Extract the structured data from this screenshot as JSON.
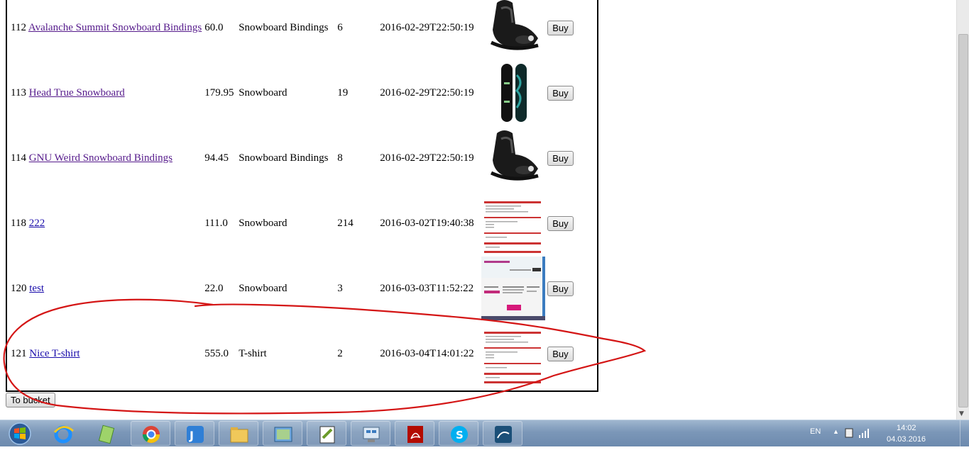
{
  "products": [
    {
      "id": "112",
      "name": "Avalanche Summit Snowboard Bindings",
      "visited": true,
      "price": "60.0",
      "category": "Snowboard Bindings",
      "quantity": "6",
      "date": "2016-02-29T22:50:19",
      "image": "bindings-photo",
      "buy_label": "Buy"
    },
    {
      "id": "113",
      "name": "Head True Snowboard",
      "visited": true,
      "price": "179.95",
      "category": "Snowboard",
      "quantity": "19",
      "date": "2016-02-29T22:50:19",
      "image": "snowboard-photo",
      "buy_label": "Buy"
    },
    {
      "id": "114",
      "name": "GNU Weird Snowboard Bindings",
      "visited": true,
      "price": "94.45",
      "category": "Snowboard Bindings",
      "quantity": "8",
      "date": "2016-02-29T22:50:19",
      "image": "bindings-photo",
      "buy_label": "Buy"
    },
    {
      "id": "118",
      "name": "222",
      "visited": false,
      "price": "111.0",
      "category": "Snowboard",
      "quantity": "214",
      "date": "2016-03-02T19:40:38",
      "image": "document-screenshot",
      "buy_label": "Buy"
    },
    {
      "id": "120",
      "name": "test",
      "visited": false,
      "price": "22.0",
      "category": "Snowboard",
      "quantity": "3",
      "date": "2016-03-03T11:52:22",
      "image": "webpage-screenshot",
      "buy_label": "Buy"
    },
    {
      "id": "121",
      "name": "Nice T-shirt",
      "visited": false,
      "price": "555.0",
      "category": "T-shirt",
      "quantity": "2",
      "date": "2016-03-04T14:01:22",
      "image": "document-screenshot",
      "buy_label": "Buy"
    }
  ],
  "to_bucket_label": "To bucket",
  "annotation": {
    "color": "#d41515",
    "shape": "hand-drawn ellipse around last row"
  },
  "taskbar": {
    "pinned": [
      "internet-explorer-icon",
      "notepad-icon",
      "chrome-icon",
      "intellij-idea-icon",
      "file-manager-icon",
      "photo-viewer-icon",
      "notepad-plus-plus-icon",
      "control-panel-icon",
      "acrobat-icon",
      "skype-icon",
      "mysql-workbench-icon"
    ],
    "language": "EN",
    "time": "14:02",
    "date": "04.03.2016"
  },
  "colors": {
    "link": "#1a0dab",
    "visited_link": "#551a8b",
    "annotation": "#d41515",
    "taskbar": "#7b97b8"
  }
}
